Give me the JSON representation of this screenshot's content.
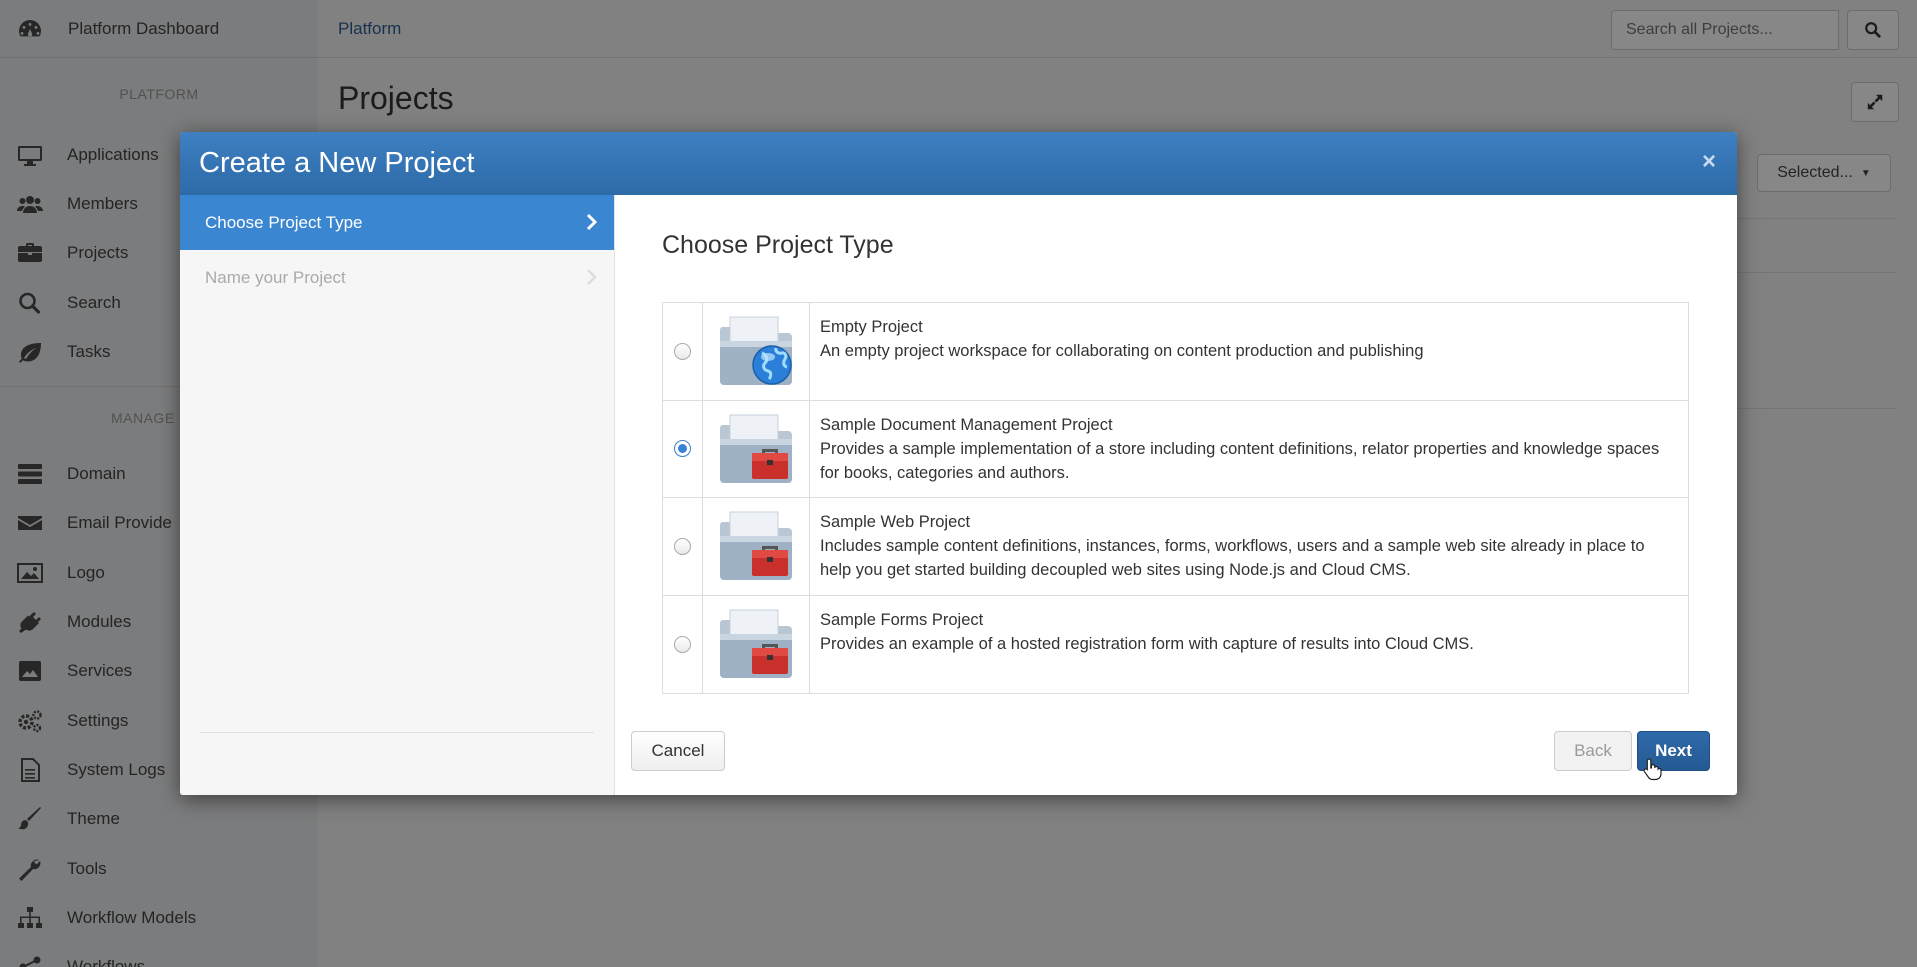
{
  "sidebar": {
    "header": "Platform Dashboard",
    "section_platform": "PLATFORM",
    "platform_items": [
      {
        "label": "Applications",
        "icon": "monitor-icon"
      },
      {
        "label": "Members",
        "icon": "users-icon"
      },
      {
        "label": "Projects",
        "icon": "briefcase-icon"
      },
      {
        "label": "Search",
        "icon": "search-icon"
      },
      {
        "label": "Tasks",
        "icon": "leaf-icon"
      }
    ],
    "section_manage": "MANAGE PLA",
    "manage_items": [
      {
        "label": "Domain",
        "icon": "server-icon"
      },
      {
        "label": "Email Provide",
        "icon": "envelope-icon"
      },
      {
        "label": "Logo",
        "icon": "image-icon"
      },
      {
        "label": "Modules",
        "icon": "plug-icon"
      },
      {
        "label": "Services",
        "icon": "picture-icon"
      },
      {
        "label": "Settings",
        "icon": "gears-icon"
      },
      {
        "label": "System Logs",
        "icon": "document-icon"
      },
      {
        "label": "Theme",
        "icon": "brush-icon"
      },
      {
        "label": "Tools",
        "icon": "wrench-icon"
      },
      {
        "label": "Workflow Models",
        "icon": "sitemap-icon"
      },
      {
        "label": "Workflows",
        "icon": "share-icon"
      }
    ]
  },
  "topbar": {
    "breadcrumb": "Platform",
    "search_placeholder": "Search all Projects..."
  },
  "content": {
    "title": "Projects",
    "selected_label": "Selected..."
  },
  "modal": {
    "title": "Create a New Project",
    "steps": [
      {
        "label": "Choose Project Type",
        "active": true
      },
      {
        "label": "Name your Project",
        "active": false
      }
    ],
    "panel_title": "Choose Project Type",
    "project_types": [
      {
        "name": "Empty Project",
        "description": "An empty project workspace for collaborating on content production and publishing",
        "selected": false,
        "icon": "folder-globe-icon"
      },
      {
        "name": "Sample Document Management Project",
        "description": "Provides a sample implementation of a store including content definitions, relator properties and knowledge spaces for books, categories and authors.",
        "selected": true,
        "icon": "folder-toolbox-icon"
      },
      {
        "name": "Sample Web Project",
        "description": "Includes sample content definitions, instances, forms, workflows, users and a sample web site already in place to help you get started building decoupled web sites using Node.js and Cloud CMS.",
        "selected": false,
        "icon": "folder-toolbox-icon"
      },
      {
        "name": "Sample Forms Project",
        "description": "Provides an example of a hosted registration form with capture of results into Cloud CMS.",
        "selected": false,
        "icon": "folder-toolbox-icon"
      }
    ],
    "cancel_label": "Cancel",
    "back_label": "Back",
    "next_label": "Next"
  },
  "colors": {
    "modal_header": "#2d6aa8",
    "active_step": "#3a86d0",
    "next_button": "#255a93",
    "toolbox_red": "#c9302c"
  }
}
